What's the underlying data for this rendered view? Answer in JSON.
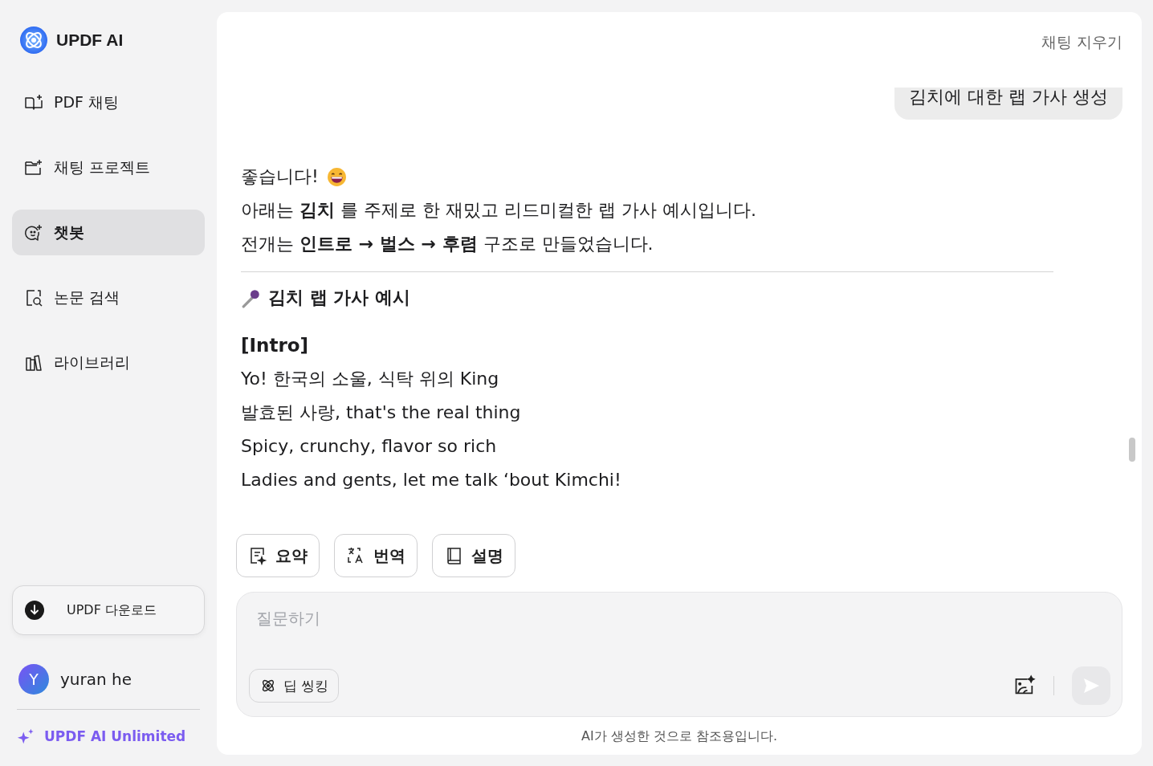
{
  "brand": {
    "name": "UPDF AI"
  },
  "nav": [
    {
      "label": "PDF 채팅",
      "selected": false
    },
    {
      "label": "채팅 프로젝트",
      "selected": false
    },
    {
      "label": "챗봇",
      "selected": true
    },
    {
      "label": "논문 검색",
      "selected": false
    },
    {
      "label": "라이브러리",
      "selected": false
    }
  ],
  "download_button": {
    "label": "UPDF 다운로드"
  },
  "user": {
    "initial": "Y",
    "name": "yuran he"
  },
  "upgrade_link": {
    "label": "UPDF AI Unlimited"
  },
  "header": {
    "clear_chat": "채팅 지우기"
  },
  "user_message": "김치에 대한 랩 가사 생성",
  "reply": {
    "intro_lines": [
      "좋습니다!",
      "아래는 **김치** 를 주제로 한 재밌고 리드미컬한 랩 가사 예시입니다.",
      "전개는 **인트로 → 벌스 → 후렴** 구조로 만들었습니다."
    ],
    "heading": "김치 랩 가사 예시",
    "section": "[Intro]",
    "lyrics": [
      "Yo! 한국의 소울, 식탁 위의 King",
      "발효된 사랑, that's the real thing",
      "Spicy, crunchy, flavor so rich",
      "Ladies and gents, let me talk ‘bout Kimchi!"
    ]
  },
  "actions": [
    {
      "label": "요약"
    },
    {
      "label": "번역"
    },
    {
      "label": "설명"
    }
  ],
  "composer": {
    "placeholder": "질문하기",
    "deep_thinking": {
      "label": "딥 씽킹",
      "on": false
    }
  },
  "footer_note": "AI가 생성한 것으로 참조용입니다."
}
